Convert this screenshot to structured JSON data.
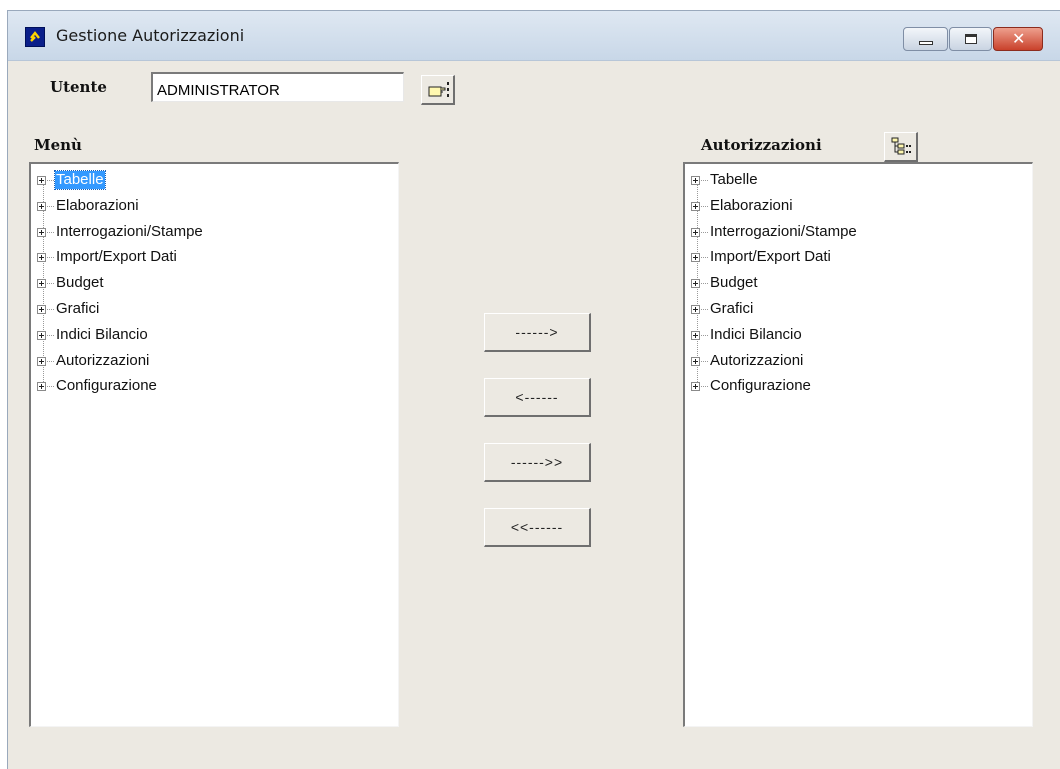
{
  "window": {
    "title": "Gestione Autorizzazioni",
    "icon": "app-icon",
    "controls": {
      "minimize": "minimize-icon",
      "maximize": "maximize-icon",
      "close": "✕"
    }
  },
  "user": {
    "label": "Utente",
    "value": "ADMINISTRATOR",
    "lookup_button_icon": "pointing-hand-icon"
  },
  "menu_panel": {
    "label": "Menù",
    "items": [
      {
        "label": "Tabelle",
        "selected": true
      },
      {
        "label": "Elaborazioni"
      },
      {
        "label": "Interrogazioni/Stampe"
      },
      {
        "label": "Import/Export Dati"
      },
      {
        "label": "Budget"
      },
      {
        "label": "Grafici"
      },
      {
        "label": "Indici Bilancio"
      },
      {
        "label": "Autorizzazioni"
      },
      {
        "label": "Configurazione"
      }
    ]
  },
  "auth_panel": {
    "label": "Autorizzazioni",
    "tree_button_icon": "tree-view-icon",
    "items": [
      {
        "label": "Tabelle"
      },
      {
        "label": "Elaborazioni"
      },
      {
        "label": "Interrogazioni/Stampe"
      },
      {
        "label": "Import/Export Dati"
      },
      {
        "label": "Budget"
      },
      {
        "label": "Grafici"
      },
      {
        "label": "Indici Bilancio"
      },
      {
        "label": "Autorizzazioni"
      },
      {
        "label": "Configurazione"
      }
    ]
  },
  "actions": {
    "add_one": "------>",
    "remove_one": "<------",
    "add_all": "------>>",
    "remove_all": "<<------"
  },
  "colors": {
    "selection": "#3399ff",
    "window_bg": "#ece9e2",
    "close_button": "#c9412b"
  }
}
